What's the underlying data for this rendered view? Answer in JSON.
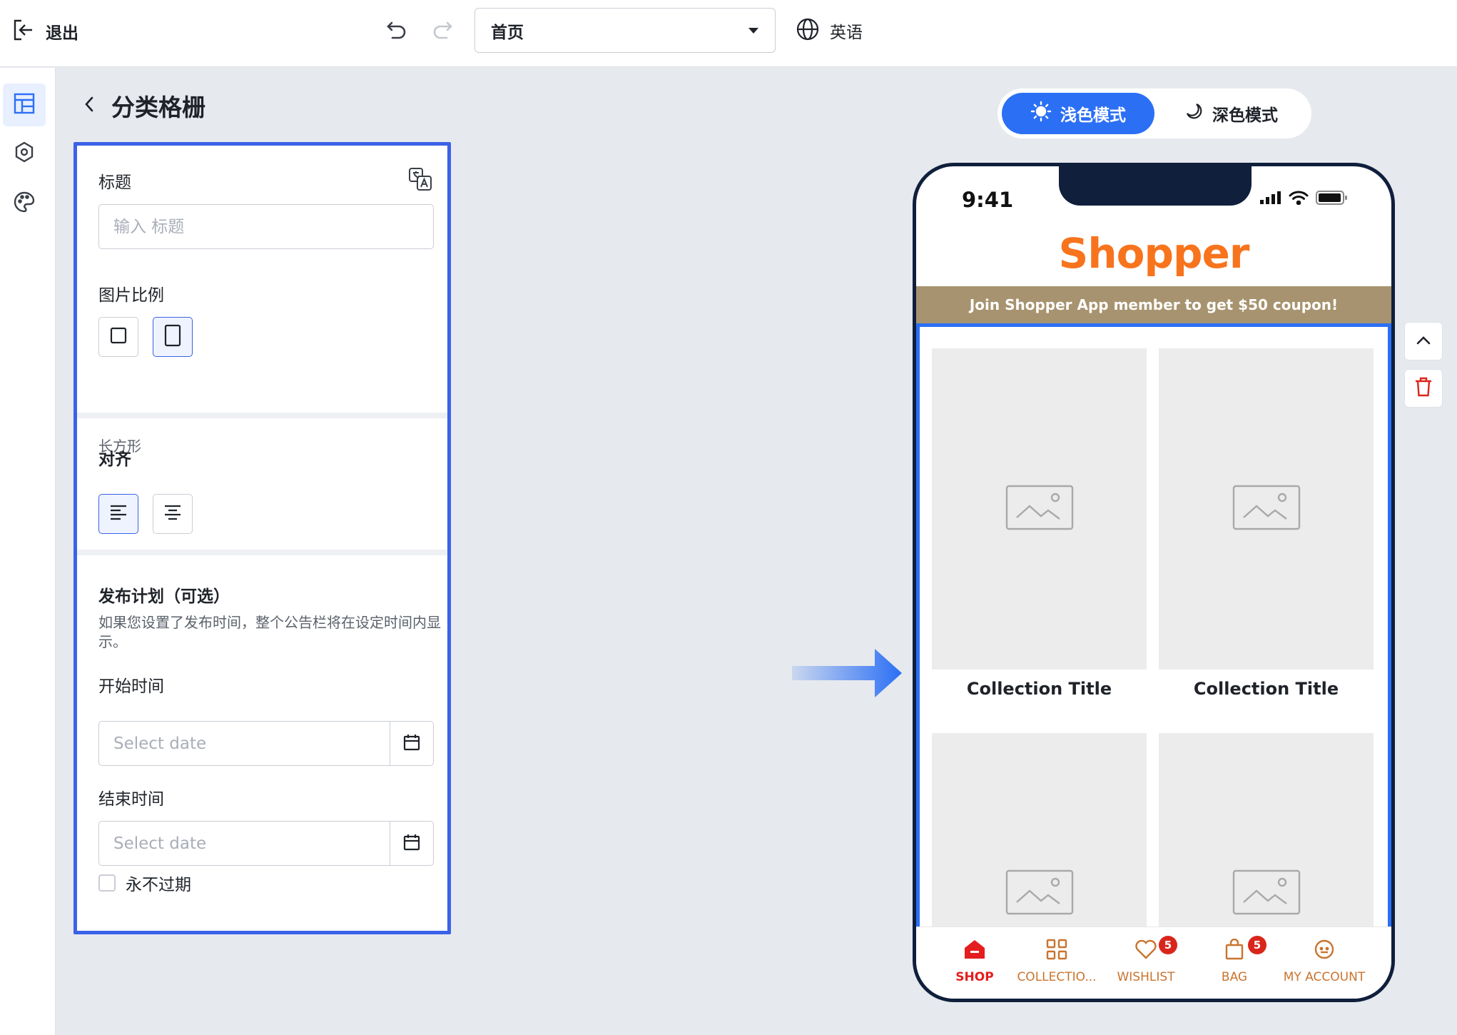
{
  "topbar": {
    "exit_label": "退出",
    "page_select_value": "首页",
    "language_label": "英语"
  },
  "panel": {
    "title": "分类格栅",
    "title_field": {
      "label": "标题",
      "placeholder": "输入 标题"
    },
    "image_ratio": {
      "label": "图片比例",
      "selected_hint": "长方形"
    },
    "alignment": {
      "label": "对齐"
    },
    "schedule": {
      "label": "发布计划（可选）",
      "description": "如果您设置了发布时间，整个公告栏将在设定时间内显示。",
      "start_label": "开始时间",
      "start_placeholder": "Select date",
      "end_label": "结束时间",
      "end_placeholder": "Select date",
      "never_expire_label": "永不过期"
    }
  },
  "preview": {
    "mode_light": "浅色模式",
    "mode_dark": "深色模式",
    "status_time": "9:41",
    "brand": "Shopper",
    "promo": "Join Shopper App member to get $50 coupon!",
    "tiles": [
      {
        "title": "Collection Title"
      },
      {
        "title": "Collection Title"
      },
      {
        "title": ""
      },
      {
        "title": ""
      }
    ],
    "tabs": [
      {
        "label": "SHOP"
      },
      {
        "label": "COLLECTIO..."
      },
      {
        "label": "WISHLIST",
        "badge": "5"
      },
      {
        "label": "BAG",
        "badge": "5"
      },
      {
        "label": "MY ACCOUNT"
      }
    ]
  },
  "colors": {
    "accent": "#3a62e8",
    "brand_orange": "#f7741d",
    "promo_bg": "#a7936f",
    "phone_frame": "#0f1f3c",
    "delete_red": "#d9261c"
  }
}
